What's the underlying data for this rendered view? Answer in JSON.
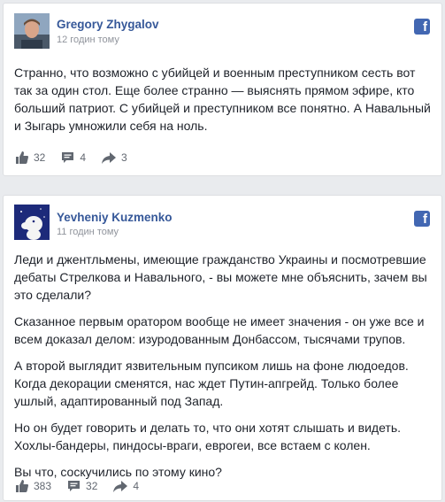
{
  "posts": [
    {
      "author": "Gregory Zhygalov",
      "time": "12 годин тому",
      "paragraphs": [
        "Странно, что возможно с убийцей и военным преступником сесть вот так за один стол. Еще более странно — выяснять прямом эфире, кто больший патриот. С убийцей и преступником все понятно. А Навальный и Зыгарь умножили себя на ноль."
      ],
      "likes": "32",
      "comments": "4",
      "shares": "3"
    },
    {
      "author": "Yevheniy Kuzmenko",
      "time": "11 годин тому",
      "paragraphs": [
        "Леди и джентльмены, имеющие гражданство Украины и посмотревшие дебаты Стрелкова и Навального, - вы можете мне объяснить, зачем вы это сделали?",
        "Сказанное первым оратором вообще не имеет значения - он уже все и всем доказал делом: изуродованным Донбассом, тысячами трупов.",
        "А второй выглядит язвительным пупсиком лишь на фоне людоедов. Когда декорации сменятся, нас ждет Путин-апгрейд. Только более ушлый, адаптированный под Запад.",
        "Но он будет говорить и делать то, что они хотят слышать и видеть. Хохлы-бандеры, пиндосы-враги, еврогеи, все встаем с колен.",
        "Вы что, соскучились по этому кино?"
      ],
      "likes": "383",
      "comments": "32",
      "shares": "4"
    }
  ],
  "icons": {
    "facebook": "f",
    "like": "thumbs-up-icon",
    "comment": "comment-icon",
    "share": "share-icon"
  },
  "colors": {
    "author": "#365899",
    "facebook": "#4267b2",
    "meta": "#90949c",
    "action": "#616770"
  }
}
